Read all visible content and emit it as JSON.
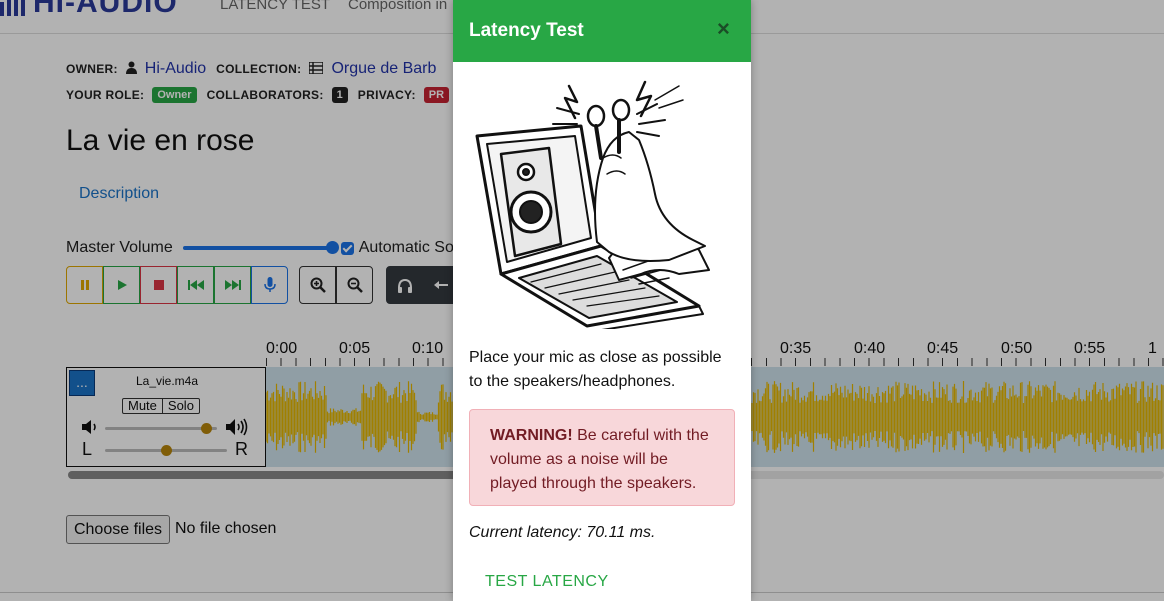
{
  "navbar": {
    "brand": "HI-AUDIO",
    "links": [
      "LATENCY TEST",
      "Composition in"
    ]
  },
  "meta": {
    "owner_label": "OWNER:",
    "owner_name": "Hi-Audio",
    "collection_label": "COLLECTION:",
    "collection_name": "Orgue de Barb",
    "role_label": "YOUR ROLE:",
    "role_badge": "Owner",
    "collaborators_label": "COLLABORATORS:",
    "collaborators_count": "1",
    "privacy_label": "PRIVACY:",
    "privacy_badge": "PR"
  },
  "song": {
    "title": "La vie en rose",
    "description_tab": "Description"
  },
  "master": {
    "label": "Master Volume",
    "volume": 0.9,
    "auto_label": "Automatic So"
  },
  "timeline": {
    "labels": [
      "0:00",
      "0:05",
      "0:10",
      "0:35",
      "0:40",
      "0:45",
      "0:50",
      "0:55",
      "1"
    ]
  },
  "track": {
    "menu": "...",
    "name": "La_vie.m4a",
    "mute": "Mute",
    "solo": "Solo",
    "left": "L",
    "right": "R",
    "volume": 0.9,
    "pan": 0.5
  },
  "file_input": {
    "button": "Choose files",
    "status": "No file chosen"
  },
  "modal": {
    "title": "Latency Test",
    "close": "×",
    "instruction": "Place your mic as close as possible to the speakers/headphones.",
    "warning_strong": "WARNING!",
    "warning_text": " Be careful with the volume as a noise will be played through the speakers.",
    "latency_text": "Current latency: 70.11 ms.",
    "test_button": "TEST LATENCY"
  },
  "colors": {
    "header_green": "#28a745",
    "warning_bg": "#f8d7da",
    "waveform": "#e6b800",
    "link_blue": "#1a73c8"
  }
}
